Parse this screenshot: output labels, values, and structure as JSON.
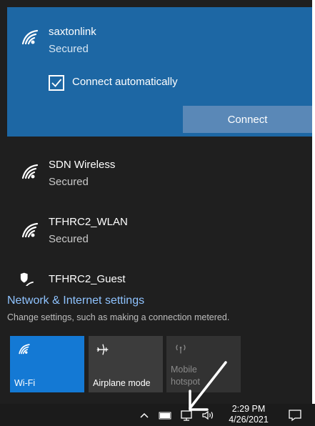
{
  "networks": {
    "selected": {
      "name": "saxtonlink",
      "status": "Secured",
      "auto_connect_label": "Connect automatically",
      "auto_connect_checked": true,
      "connect_label": "Connect"
    },
    "items": [
      {
        "name": "SDN Wireless",
        "status": "Secured"
      },
      {
        "name": "TFHRC2_WLAN",
        "status": "Secured"
      },
      {
        "name": "TFHRC2_Guest",
        "status": ""
      }
    ]
  },
  "settings": {
    "title": "Network & Internet settings",
    "description": "Change settings, such as making a connection metered."
  },
  "quick_actions": [
    {
      "label": "Wi-Fi",
      "icon": "wifi-icon",
      "state": "on"
    },
    {
      "label": "Airplane mode",
      "icon": "airplane-icon",
      "state": "off"
    },
    {
      "label": "Mobile hotspot",
      "icon": "hotspot-icon",
      "state": "disabled"
    }
  ],
  "taskbar": {
    "time": "2:29 PM",
    "date": "4/26/2021",
    "icons": [
      "chevron-up-icon",
      "battery-icon",
      "network-icon",
      "volume-icon",
      "notification-icon"
    ]
  },
  "colors": {
    "selected_bg": "#1d67a4",
    "connect_button": "#5a88b7",
    "panel_bg": "#1f1f1f",
    "link": "#8fc3ff",
    "wifi_tile": "#1479d4"
  }
}
